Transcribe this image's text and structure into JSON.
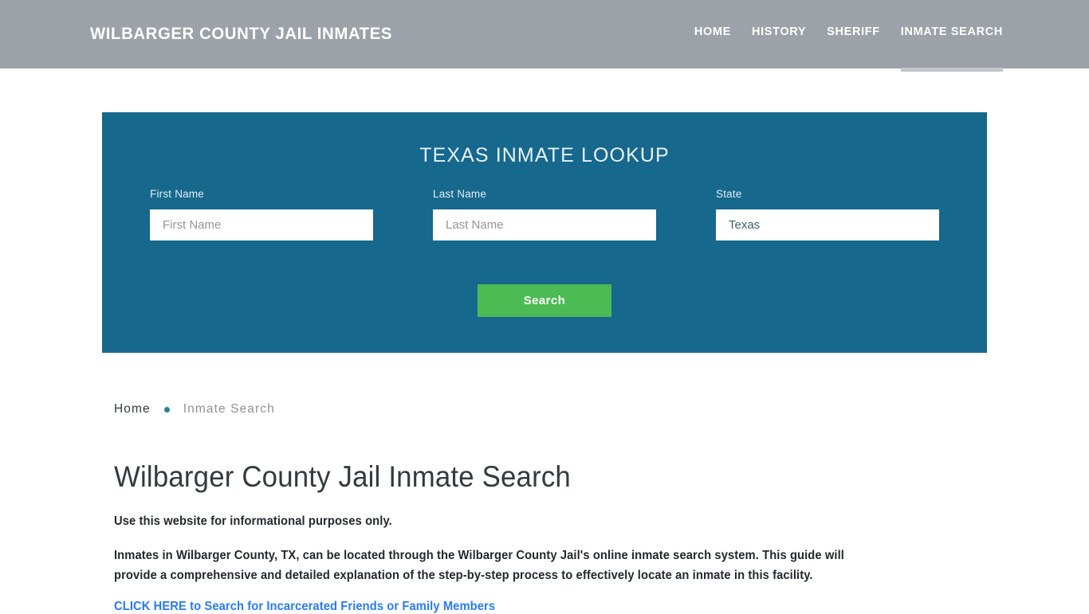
{
  "header": {
    "brand": "WILBARGER COUNTY JAIL INMATES",
    "brand_color": "#ffffff",
    "bar_color": "#9ca2a7",
    "nav": [
      {
        "label": "HOME",
        "active": false
      },
      {
        "label": "HISTORY",
        "active": false
      },
      {
        "label": "SHERIFF",
        "active": false
      },
      {
        "label": "INMATE SEARCH",
        "active": true
      }
    ]
  },
  "lookup": {
    "title": "TEXAS INMATE LOOKUP",
    "panel_color": "#16688d",
    "fields": {
      "first_name": {
        "label": "First Name",
        "placeholder": "First Name",
        "value": ""
      },
      "last_name": {
        "label": "Last Name",
        "placeholder": "Last Name",
        "value": ""
      },
      "state": {
        "label": "State",
        "placeholder": "State",
        "value": "Texas",
        "options": [
          "Texas"
        ]
      }
    },
    "search_button": {
      "label": "Search",
      "color": "#4cbb54"
    }
  },
  "breadcrumb": {
    "home": "Home",
    "separator": "•",
    "current": "Inmate Search"
  },
  "main": {
    "title": "Wilbarger County Jail Inmate Search",
    "paragraph_1": "Use this website for informational purposes only.",
    "paragraph_2": "Inmates in Wilbarger County, TX, can be located through the Wilbarger County Jail's online inmate search system. This guide will provide a comprehensive and detailed explanation of the step-by-step process to effectively locate an inmate in this facility.",
    "cta_link": "CLICK HERE to Search for Incarcerated Friends or Family Members",
    "cta_link_color": "#2a7af0"
  }
}
